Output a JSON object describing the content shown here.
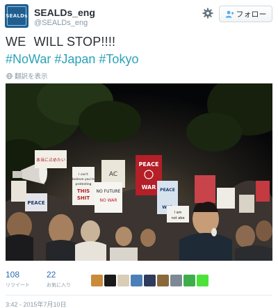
{
  "account": {
    "display_name": "SEALDs_eng",
    "screen_name": "@SEALDs_eng",
    "avatar_text": "SEALDs"
  },
  "header": {
    "settings_icon": "gear-icon",
    "follow_label": "フォロー",
    "follow_icon": "add-user-icon"
  },
  "tweet": {
    "text_part1": "WE",
    "text_part2": "WILL STOP!!!!",
    "hashtags": [
      "#NoWar",
      "#Japan",
      "#Tokyo"
    ],
    "translate_label": "翻訳を表示",
    "translate_icon": "globe-icon"
  },
  "photo": {
    "signs": [
      "本当に止めたい",
      "AC",
      "PEACE NOT WAR",
      "I can't believe you're going to still be protesting THIS SHIT",
      "NO FUTURE NO WAR",
      "PEACE NOT WAR",
      "PEACE",
      "I am not abe"
    ]
  },
  "stats": {
    "retweets": {
      "count": "108",
      "label": "リツイート"
    },
    "favorites": {
      "count": "22",
      "label": "お気に入り"
    }
  },
  "favoriter_avatars": [
    "#c98a3a",
    "#1a1a1a",
    "#d9cdb8",
    "#4c7fb8",
    "#2f3b5c",
    "#8a6a3a",
    "#7d8a95",
    "#3fae4a",
    "#4de23a"
  ],
  "timestamp": "3:42 - 2015年7月10日",
  "colors": {
    "hashtag": "#2aa3b8",
    "link": "#2a6cad",
    "muted": "#8899a6"
  }
}
